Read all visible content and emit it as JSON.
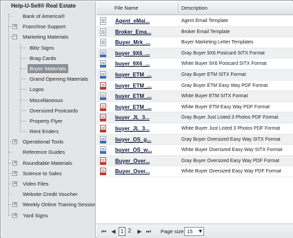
{
  "tree": {
    "root": "Help-U-Sell® Real Estate",
    "items": [
      {
        "label": "Bank of America®",
        "level": 1,
        "toggle": ""
      },
      {
        "label": "Franchise Support",
        "level": 1,
        "toggle": "+"
      },
      {
        "label": "Marketing Materials",
        "level": 1,
        "toggle": "−"
      },
      {
        "label": "Blitz Signs",
        "level": 2
      },
      {
        "label": "Brag Cards",
        "level": 2
      },
      {
        "label": "Buyer Materials",
        "level": 2,
        "selected": true
      },
      {
        "label": "Grand Opening Materials",
        "level": 2
      },
      {
        "label": "Logos",
        "level": 2
      },
      {
        "label": "Miscellaneous",
        "level": 2
      },
      {
        "label": "Oversized Postcards",
        "level": 2
      },
      {
        "label": "Property Flyer",
        "level": 2
      },
      {
        "label": "Rent Enders",
        "level": 2
      },
      {
        "label": "Operational Tools",
        "level": 1,
        "toggle": "+"
      },
      {
        "label": "Reference Guides",
        "level": 1,
        "toggle": ""
      },
      {
        "label": "Roundtable Materials",
        "level": 1,
        "toggle": "+"
      },
      {
        "label": "Science to Sales",
        "level": 1,
        "toggle": "+"
      },
      {
        "label": "Video Files",
        "level": 1,
        "toggle": "+"
      },
      {
        "label": "Website Credit Voucher",
        "level": 1,
        "toggle": ""
      },
      {
        "label": "Weekly Online Training Sessions",
        "level": 1,
        "toggle": "+"
      },
      {
        "label": "Yard Signs",
        "level": 1,
        "toggle": "+"
      }
    ]
  },
  "grid": {
    "columns": {
      "file_name": "File Name",
      "description": "Description"
    },
    "rows": [
      {
        "name": "Agent_eMai...",
        "description": "Agent Email Template",
        "icon": "doc-icon"
      },
      {
        "name": "Broker_Ema...",
        "description": "Broker Email Template",
        "icon": "doc-icon"
      },
      {
        "name": "Buyer_Mrk_...",
        "description": "Buyer Marketing Letter Templates",
        "icon": "doc-icon"
      },
      {
        "name": "buyer_9X6_...",
        "description": "Gray Buyer 9X6 Postcard SITX Format",
        "icon": "sitx-icon"
      },
      {
        "name": "buyer_9X6_...",
        "description": "White Buyer 9X6 Postcard SITX Format",
        "icon": "sitx-icon"
      },
      {
        "name": "buyer_ETM_...",
        "description": "Gray Buyer ETM SITX Format",
        "icon": "sitx-icon"
      },
      {
        "name": "buyer_ETM_...",
        "description": "Gray Buyer ETM Easy Way PDF Format",
        "icon": "pdf-icon"
      },
      {
        "name": "buyer_ETM_...",
        "description": "White Buyer ETM SITX Format",
        "icon": "sitx-icon"
      },
      {
        "name": "buyer_ETM_...",
        "description": "White Buyer ETM Easy Way PDF Format",
        "icon": "pdf-icon"
      },
      {
        "name": "buyer_JL_3...",
        "description": "Gray Buyer Just Listed 3 Photos PDF Format",
        "icon": "pdf-icon"
      },
      {
        "name": "buyer_JL_3...",
        "description": "White Buyer Just Listed 3 Photos PDF Format",
        "icon": "pdf-icon"
      },
      {
        "name": "buyer_OS_g...",
        "description": "Gray Buyer Oversized Easy Way SITX Format",
        "icon": "sitx-icon"
      },
      {
        "name": "buyer_OS_w...",
        "description": "White Buyer Oversized Easy Way SITX Format",
        "icon": "sitx-icon"
      },
      {
        "name": "Buyer_Over...",
        "description": "Gray Buyer Oversized Easy Way PDF Format",
        "icon": "pdf-icon"
      },
      {
        "name": "Buyer_Over...",
        "description": "White Buyer Oversized Easy Way PDF Format",
        "icon": "pdf-icon"
      }
    ]
  },
  "pager": {
    "first": "⏮",
    "prev": "◀",
    "pages": [
      "1",
      "2"
    ],
    "current_page": "1",
    "next": "▶",
    "last": "⏭",
    "page_size_label": "Page size:",
    "page_size_value": "15"
  }
}
